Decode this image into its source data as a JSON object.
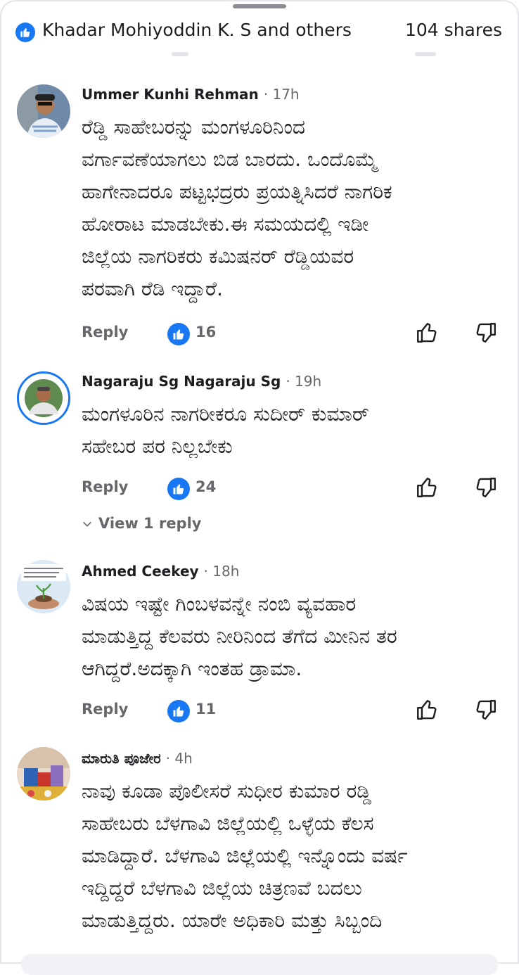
{
  "header": {
    "reactors": "Khadar Mohiyoddin K. S and others",
    "shares": "104 shares"
  },
  "comments": [
    {
      "author": "Ummer Kunhi Rehman",
      "time": "· 17h",
      "lines": [
        "ರೆಡ್ಡಿ ಸಾಹೇಬರನ್ನು ಮಂಗಳೂರಿನಿಂದ",
        "ವರ್ಗಾವಣೆಯಾಗಲು ಬಿಡ ಬಾರದು. ಒಂದೊಮ್ಮೆ",
        "ಹಾಗೇನಾದರೂ ಪಟ್ಟಭದ್ರರು  ಪ್ರಯತ್ನಿಸಿದರೆ ನಾಗರಿಕ",
        "ಹೋರಾಟ ಮಾಡಬೇಕು.ಈ ಸಮಯದಲ್ಲಿ ಇಡೀ",
        "ಜಿಲ್ಲೆಯ ನಾಗರಿಕರು ಕಮಿಷನರ್ ರೆಡ್ಡಿಯವರ",
        "ಪರವಾಗಿ ರೆಡಿ ಇದ್ದಾರೆ."
      ],
      "reply_label": "Reply",
      "reaction_count": "16"
    },
    {
      "author": "Nagaraju Sg Nagaraju Sg",
      "time": "· 19h",
      "lines": [
        "ಮಂಗಳೂರಿನ ನಾಗರೀಕರೂ ಸುದೀರ್ ಕುಮಾರ್",
        "ಸಹೇಬರ ಪರ ನಿಲ್ಲಬೇಕು"
      ],
      "reply_label": "Reply",
      "reaction_count": "24",
      "view_replies": "View 1 reply"
    },
    {
      "author": "Ahmed Ceekey",
      "time": "· 18h",
      "lines": [
        "ವಿಷಯ ಇಷ್ಟೇ ಗಿಂಬಳವನ್ನೇ ನಂಬಿ ವ್ಯವಹಾರ",
        "ಮಾಡುತ್ತಿದ್ದ ಕೆಲವರು ನೀರಿನಿಂದ ತೆಗೆದ ಮೀನಿನ ತರ",
        "ಆಗಿದ್ದರೆ.ಅದಕ್ಕಾಗಿ ಇಂತಹ ಡ್ರಾಮಾ."
      ],
      "reply_label": "Reply",
      "reaction_count": "11"
    },
    {
      "author": "ಮಾರುತಿ ಪೂಜೇರ",
      "time": "· 4h",
      "lines": [
        "ನಾವು ಕೂಡಾ ಪೊಲೀಸರೆ ಸುಧೀರ ಕುಮಾರ ರಡ್ಡಿ",
        "ಸಾಹೇಬರು ಬೆಳಗಾವಿ ಜಿಲ್ಲೆಯಲ್ಲಿ ಒಳ್ಳೆಯ ಕೆಲಸ",
        "ಮಾಡಿದ್ದಾರೆ. ಬೆಳಗಾವಿ ಜಿಲ್ಲೆಯಲ್ಲಿ ಇನ್ನೊಂದು ವರ್ಷ",
        "ಇದ್ದಿದ್ದರೆ ಬೆಳಗಾವಿ ಜಿಲ್ಲೆಯ ಚಿತ್ರಣವೆ ಬದಲು",
        "ಮಾಡುತ್ತಿದ್ದರು. ಯಾರೇ ಅಧಿಕಾರಿ ಮತ್ತು ಸಿಬ್ಬಂದಿ"
      ]
    }
  ],
  "colors": {
    "brand_blue": "#1877f2",
    "secondary_text": "#65676b",
    "primary_text": "#1c1e21"
  },
  "icons": [
    "like-icon",
    "thumbs-up-outline-icon",
    "thumbs-down-outline-icon",
    "chevron-down-icon"
  ]
}
